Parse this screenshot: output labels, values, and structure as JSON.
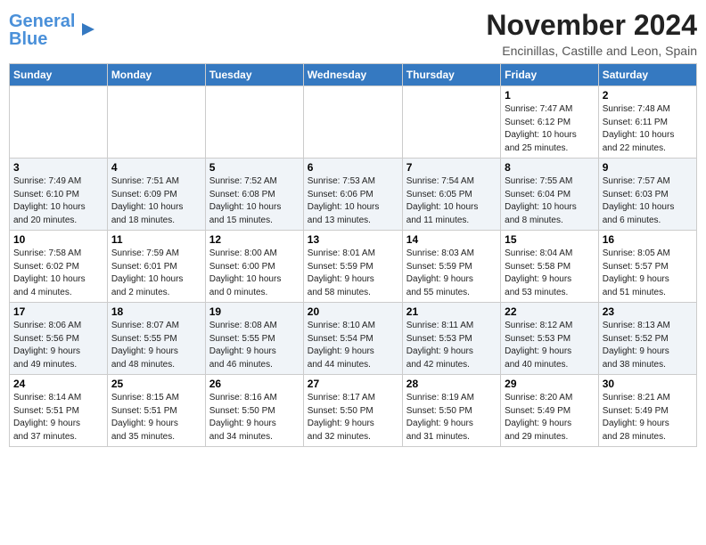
{
  "header": {
    "logo_general": "General",
    "logo_blue": "Blue",
    "month": "November 2024",
    "location": "Encinillas, Castille and Leon, Spain"
  },
  "days_of_week": [
    "Sunday",
    "Monday",
    "Tuesday",
    "Wednesday",
    "Thursday",
    "Friday",
    "Saturday"
  ],
  "weeks": [
    [
      {
        "day": "",
        "info": ""
      },
      {
        "day": "",
        "info": ""
      },
      {
        "day": "",
        "info": ""
      },
      {
        "day": "",
        "info": ""
      },
      {
        "day": "",
        "info": ""
      },
      {
        "day": "1",
        "info": "Sunrise: 7:47 AM\nSunset: 6:12 PM\nDaylight: 10 hours\nand 25 minutes."
      },
      {
        "day": "2",
        "info": "Sunrise: 7:48 AM\nSunset: 6:11 PM\nDaylight: 10 hours\nand 22 minutes."
      }
    ],
    [
      {
        "day": "3",
        "info": "Sunrise: 7:49 AM\nSunset: 6:10 PM\nDaylight: 10 hours\nand 20 minutes."
      },
      {
        "day": "4",
        "info": "Sunrise: 7:51 AM\nSunset: 6:09 PM\nDaylight: 10 hours\nand 18 minutes."
      },
      {
        "day": "5",
        "info": "Sunrise: 7:52 AM\nSunset: 6:08 PM\nDaylight: 10 hours\nand 15 minutes."
      },
      {
        "day": "6",
        "info": "Sunrise: 7:53 AM\nSunset: 6:06 PM\nDaylight: 10 hours\nand 13 minutes."
      },
      {
        "day": "7",
        "info": "Sunrise: 7:54 AM\nSunset: 6:05 PM\nDaylight: 10 hours\nand 11 minutes."
      },
      {
        "day": "8",
        "info": "Sunrise: 7:55 AM\nSunset: 6:04 PM\nDaylight: 10 hours\nand 8 minutes."
      },
      {
        "day": "9",
        "info": "Sunrise: 7:57 AM\nSunset: 6:03 PM\nDaylight: 10 hours\nand 6 minutes."
      }
    ],
    [
      {
        "day": "10",
        "info": "Sunrise: 7:58 AM\nSunset: 6:02 PM\nDaylight: 10 hours\nand 4 minutes."
      },
      {
        "day": "11",
        "info": "Sunrise: 7:59 AM\nSunset: 6:01 PM\nDaylight: 10 hours\nand 2 minutes."
      },
      {
        "day": "12",
        "info": "Sunrise: 8:00 AM\nSunset: 6:00 PM\nDaylight: 10 hours\nand 0 minutes."
      },
      {
        "day": "13",
        "info": "Sunrise: 8:01 AM\nSunset: 5:59 PM\nDaylight: 9 hours\nand 58 minutes."
      },
      {
        "day": "14",
        "info": "Sunrise: 8:03 AM\nSunset: 5:59 PM\nDaylight: 9 hours\nand 55 minutes."
      },
      {
        "day": "15",
        "info": "Sunrise: 8:04 AM\nSunset: 5:58 PM\nDaylight: 9 hours\nand 53 minutes."
      },
      {
        "day": "16",
        "info": "Sunrise: 8:05 AM\nSunset: 5:57 PM\nDaylight: 9 hours\nand 51 minutes."
      }
    ],
    [
      {
        "day": "17",
        "info": "Sunrise: 8:06 AM\nSunset: 5:56 PM\nDaylight: 9 hours\nand 49 minutes."
      },
      {
        "day": "18",
        "info": "Sunrise: 8:07 AM\nSunset: 5:55 PM\nDaylight: 9 hours\nand 48 minutes."
      },
      {
        "day": "19",
        "info": "Sunrise: 8:08 AM\nSunset: 5:55 PM\nDaylight: 9 hours\nand 46 minutes."
      },
      {
        "day": "20",
        "info": "Sunrise: 8:10 AM\nSunset: 5:54 PM\nDaylight: 9 hours\nand 44 minutes."
      },
      {
        "day": "21",
        "info": "Sunrise: 8:11 AM\nSunset: 5:53 PM\nDaylight: 9 hours\nand 42 minutes."
      },
      {
        "day": "22",
        "info": "Sunrise: 8:12 AM\nSunset: 5:53 PM\nDaylight: 9 hours\nand 40 minutes."
      },
      {
        "day": "23",
        "info": "Sunrise: 8:13 AM\nSunset: 5:52 PM\nDaylight: 9 hours\nand 38 minutes."
      }
    ],
    [
      {
        "day": "24",
        "info": "Sunrise: 8:14 AM\nSunset: 5:51 PM\nDaylight: 9 hours\nand 37 minutes."
      },
      {
        "day": "25",
        "info": "Sunrise: 8:15 AM\nSunset: 5:51 PM\nDaylight: 9 hours\nand 35 minutes."
      },
      {
        "day": "26",
        "info": "Sunrise: 8:16 AM\nSunset: 5:50 PM\nDaylight: 9 hours\nand 34 minutes."
      },
      {
        "day": "27",
        "info": "Sunrise: 8:17 AM\nSunset: 5:50 PM\nDaylight: 9 hours\nand 32 minutes."
      },
      {
        "day": "28",
        "info": "Sunrise: 8:19 AM\nSunset: 5:50 PM\nDaylight: 9 hours\nand 31 minutes."
      },
      {
        "day": "29",
        "info": "Sunrise: 8:20 AM\nSunset: 5:49 PM\nDaylight: 9 hours\nand 29 minutes."
      },
      {
        "day": "30",
        "info": "Sunrise: 8:21 AM\nSunset: 5:49 PM\nDaylight: 9 hours\nand 28 minutes."
      }
    ]
  ]
}
